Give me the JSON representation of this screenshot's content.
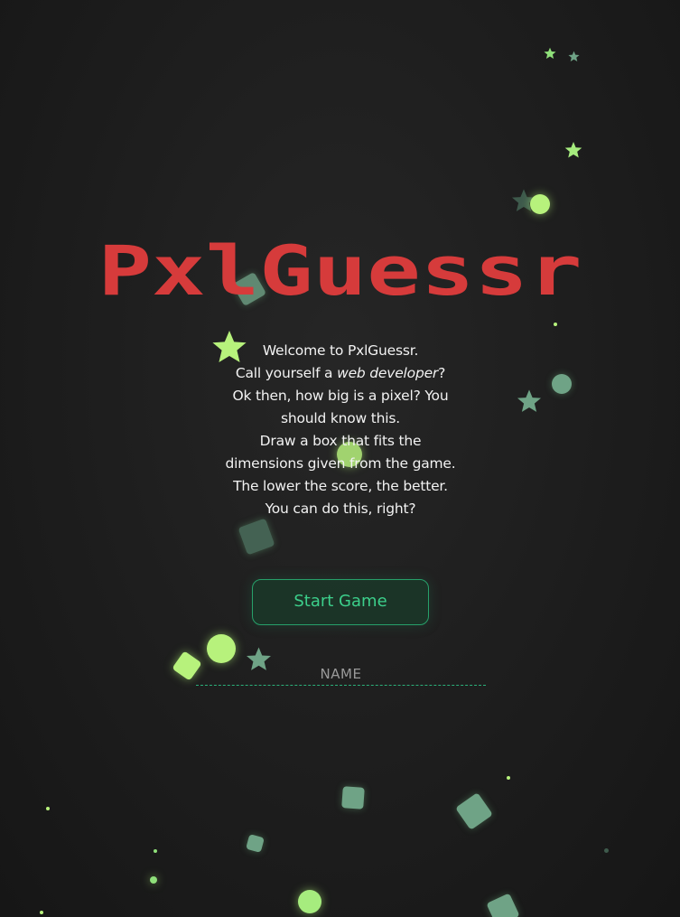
{
  "app": {
    "logo_text": "PxlGuessr"
  },
  "colors": {
    "logo": "#d63b3b",
    "accent": "#2bb07a",
    "particle_bright": "#b7f27c",
    "particle_dim": "#6fa386",
    "text": "#f2f2f2"
  },
  "intro": {
    "line1": "Welcome to PxlGuessr.",
    "line2_pre": "Call yourself a ",
    "line2_em": "web developer",
    "line2_post": "?",
    "line3": "Ok then, how big is a pixel? You should know this.",
    "line4": "Draw a box that fits the dimensions given from the game. The lower the score, the better.",
    "line5": "You can do this, right?"
  },
  "start_button": {
    "label": "Start Game"
  },
  "name_input": {
    "placeholder": "NAME",
    "value": ""
  }
}
